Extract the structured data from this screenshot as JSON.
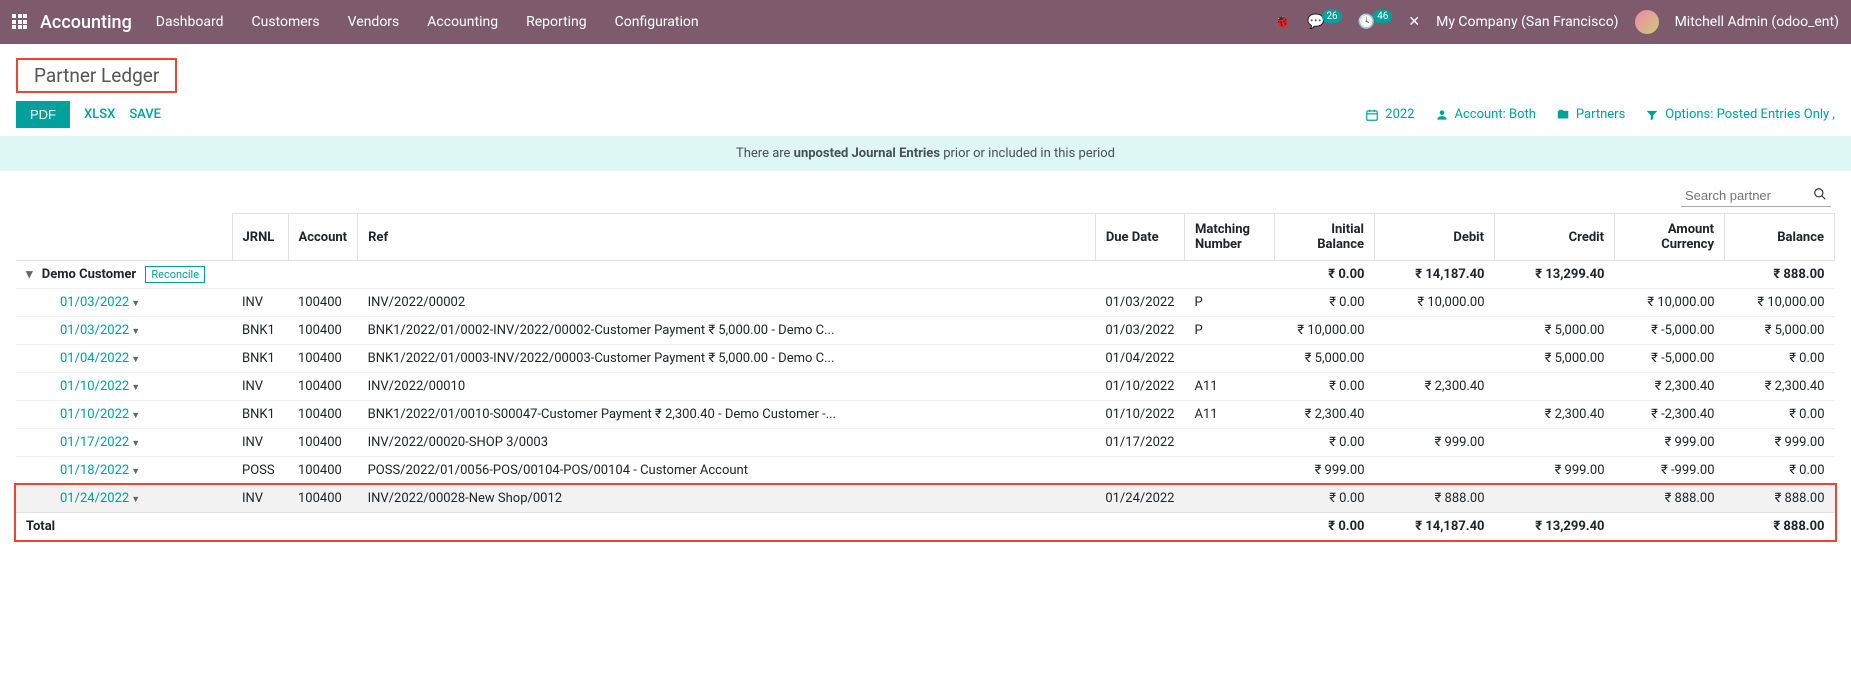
{
  "topnav": {
    "brand": "Accounting",
    "menu": [
      "Dashboard",
      "Customers",
      "Vendors",
      "Accounting",
      "Reporting",
      "Configuration"
    ],
    "msg_badge": "26",
    "activity_badge": "46",
    "company": "My Company (San Francisco)",
    "user": "Mitchell Admin (odoo_ent)"
  },
  "page_title": "Partner Ledger",
  "buttons": {
    "pdf": "PDF",
    "xlsx": "XLSX",
    "save": "SAVE"
  },
  "filters": {
    "year": "2022",
    "account": "Account: Both",
    "partners": "Partners",
    "options": "Options: Posted Entries Only ,"
  },
  "warning": {
    "pre": "There are ",
    "bold": "unposted Journal Entries",
    "post": " prior or included in this period"
  },
  "search_placeholder": "Search partner",
  "headers": {
    "jrnl": "JRNL",
    "account": "Account",
    "ref": "Ref",
    "due": "Due Date",
    "match": "Matching Number",
    "initial": "Initial Balance",
    "debit": "Debit",
    "credit": "Credit",
    "amtcur": "Amount Currency",
    "balance": "Balance"
  },
  "partner": {
    "name": "Demo Customer",
    "reconcile": "Reconcile",
    "initial": "₹ 0.00",
    "debit": "₹ 14,187.40",
    "credit": "₹ 13,299.40",
    "amtcur": "",
    "balance": "₹ 888.00"
  },
  "lines": [
    {
      "date": "01/03/2022",
      "jrnl": "INV",
      "acct": "100400",
      "ref": "INV/2022/00002",
      "due": "01/03/2022",
      "match": "P",
      "initial": "₹ 0.00",
      "debit": "₹ 10,000.00",
      "credit": "",
      "amtcur": "₹ 10,000.00",
      "balance": "₹ 10,000.00"
    },
    {
      "date": "01/03/2022",
      "jrnl": "BNK1",
      "acct": "100400",
      "ref": "BNK1/2022/01/0002-INV/2022/00002-Customer Payment ₹ 5,000.00 - Demo C...",
      "due": "01/03/2022",
      "match": "P",
      "initial": "₹ 10,000.00",
      "debit": "",
      "credit": "₹ 5,000.00",
      "amtcur": "₹ -5,000.00",
      "balance": "₹ 5,000.00"
    },
    {
      "date": "01/04/2022",
      "jrnl": "BNK1",
      "acct": "100400",
      "ref": "BNK1/2022/01/0003-INV/2022/00003-Customer Payment ₹ 5,000.00 - Demo C...",
      "due": "01/04/2022",
      "match": "",
      "initial": "₹ 5,000.00",
      "debit": "",
      "credit": "₹ 5,000.00",
      "amtcur": "₹ -5,000.00",
      "balance": "₹ 0.00"
    },
    {
      "date": "01/10/2022",
      "jrnl": "INV",
      "acct": "100400",
      "ref": "INV/2022/00010",
      "due": "01/10/2022",
      "match": "A11",
      "initial": "₹ 0.00",
      "debit": "₹ 2,300.40",
      "credit": "",
      "amtcur": "₹ 2,300.40",
      "balance": "₹ 2,300.40"
    },
    {
      "date": "01/10/2022",
      "jrnl": "BNK1",
      "acct": "100400",
      "ref": "BNK1/2022/01/0010-S00047-Customer Payment ₹ 2,300.40 - Demo Customer -...",
      "due": "01/10/2022",
      "match": "A11",
      "initial": "₹ 2,300.40",
      "debit": "",
      "credit": "₹ 2,300.40",
      "amtcur": "₹ -2,300.40",
      "balance": "₹ 0.00"
    },
    {
      "date": "01/17/2022",
      "jrnl": "INV",
      "acct": "100400",
      "ref": "INV/2022/00020-SHOP 3/0003",
      "due": "01/17/2022",
      "match": "",
      "initial": "₹ 0.00",
      "debit": "₹ 999.00",
      "credit": "",
      "amtcur": "₹ 999.00",
      "balance": "₹ 999.00"
    },
    {
      "date": "01/18/2022",
      "jrnl": "POSS",
      "acct": "100400",
      "ref": "POSS/2022/01/0056-POS/00104-POS/00104 - Customer Account",
      "due": "",
      "match": "",
      "initial": "₹ 999.00",
      "debit": "",
      "credit": "₹ 999.00",
      "amtcur": "₹ -999.00",
      "balance": "₹ 0.00"
    },
    {
      "date": "01/24/2022",
      "jrnl": "INV",
      "acct": "100400",
      "ref": "INV/2022/00028-New Shop/0012",
      "due": "01/24/2022",
      "match": "",
      "initial": "₹ 0.00",
      "debit": "₹ 888.00",
      "credit": "",
      "amtcur": "₹ 888.00",
      "balance": "₹ 888.00",
      "highlight": true
    }
  ],
  "total": {
    "label": "Total",
    "initial": "₹ 0.00",
    "debit": "₹ 14,187.40",
    "credit": "₹ 13,299.40",
    "amtcur": "",
    "balance": "₹ 888.00"
  }
}
